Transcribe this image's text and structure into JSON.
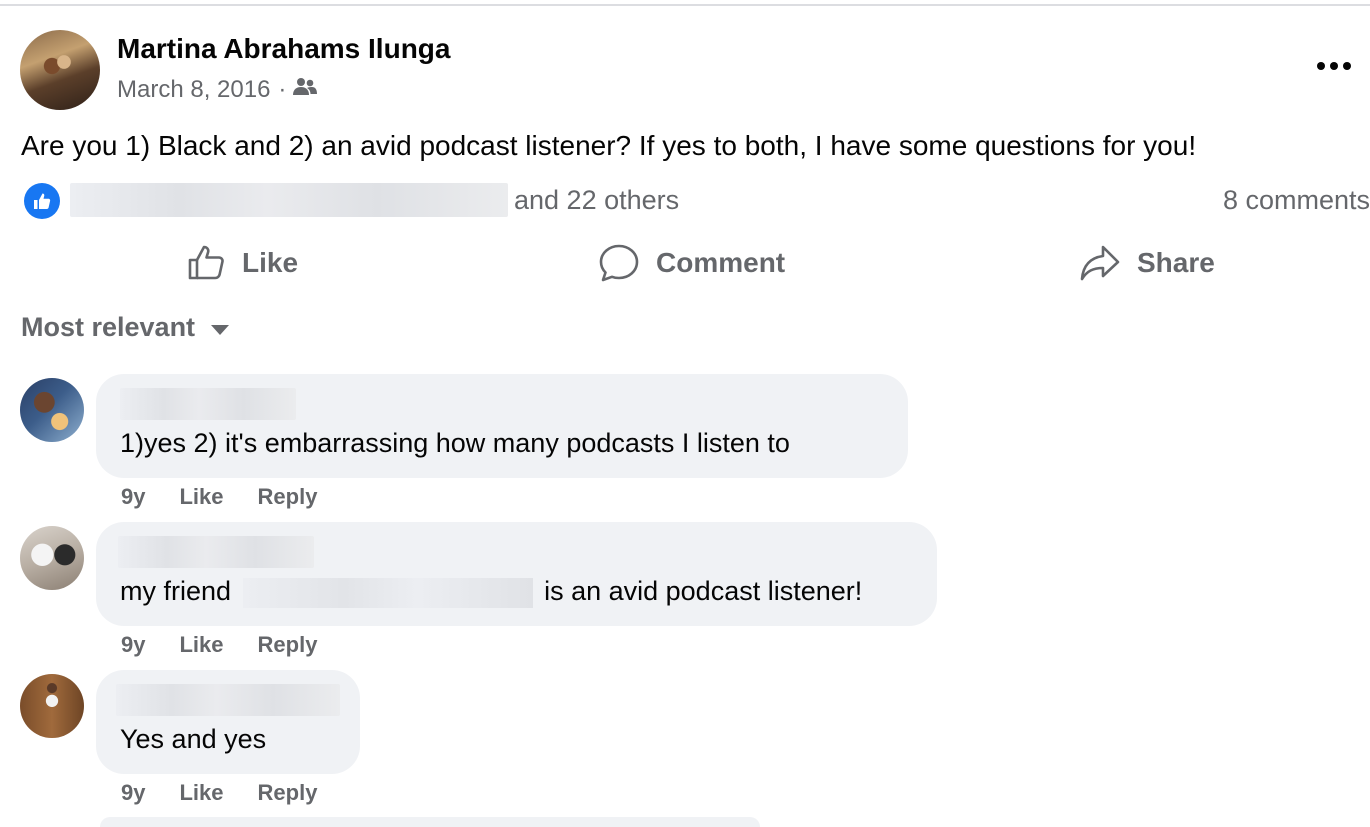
{
  "post": {
    "author": "Martina Abrahams Ilunga",
    "date": "March 8, 2016",
    "date_separator": "·",
    "audience_icon": "friends-icon",
    "more_icon": "more-options-icon",
    "text": "Are you 1) Black and 2) an avid podcast listener? If yes to both, I have some questions for you!",
    "reactions": {
      "reaction_icon": "like-reaction-icon",
      "others_text": "and 22 others",
      "comments_count_text": "8 comments"
    },
    "actions": {
      "like": "Like",
      "comment": "Comment",
      "share": "Share"
    }
  },
  "comments_section": {
    "sort_label": "Most relevant",
    "comments": [
      {
        "text": "1)yes 2) it's embarrassing how many podcasts I listen to",
        "time": "9y",
        "like": "Like",
        "reply": "Reply"
      },
      {
        "text_before": "my friend",
        "text_after": "is an avid podcast listener!",
        "time": "9y",
        "like": "Like",
        "reply": "Reply"
      },
      {
        "text": "Yes and yes",
        "time": "9y",
        "like": "Like",
        "reply": "Reply"
      }
    ]
  },
  "colors": {
    "facebook_blue": "#1877f2",
    "secondary_text": "#65676b",
    "bubble_bg": "#f0f2f5"
  }
}
